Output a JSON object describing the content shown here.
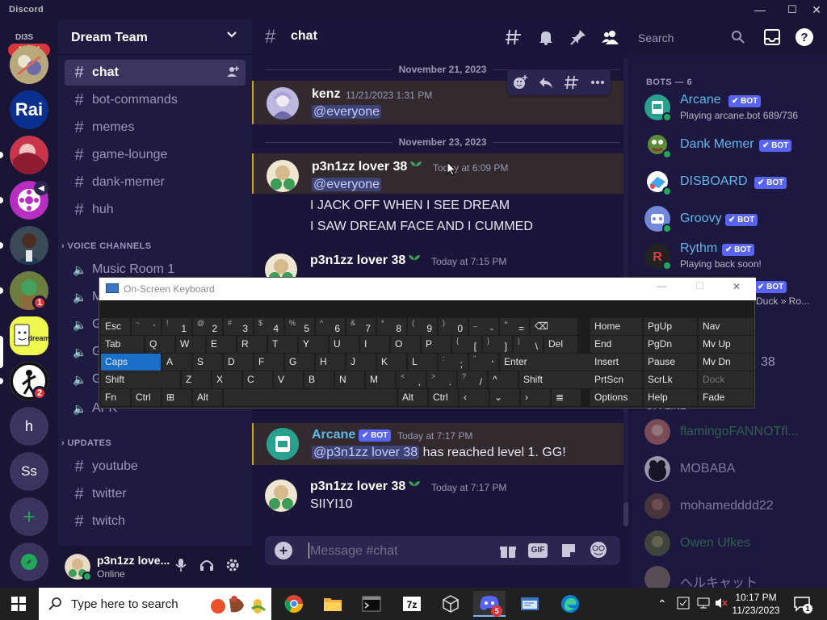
{
  "titlebar": {
    "app_name": "Discord",
    "minimize": "—",
    "maximize": "☐",
    "close": "✕"
  },
  "rail": {
    "unread_label": "DI3S",
    "new_label": "NEW",
    "servers": [
      {
        "name": "server-1"
      },
      {
        "name": "server-rai",
        "label": "Rai"
      },
      {
        "name": "server-3"
      },
      {
        "name": "server-4"
      },
      {
        "name": "server-5"
      },
      {
        "name": "server-6",
        "badge": "1"
      },
      {
        "name": "server-dream",
        "label": "dream"
      },
      {
        "name": "server-8",
        "badge": "2"
      },
      {
        "name": "server-h",
        "label": "h"
      },
      {
        "name": "server-ss",
        "label": "Ss"
      }
    ],
    "add_server": "+"
  },
  "sidebar": {
    "server_name": "Dream Team",
    "text_channels": [
      {
        "name": "chat",
        "active": true
      },
      {
        "name": "bot-commands"
      },
      {
        "name": "memes"
      },
      {
        "name": "game-lounge"
      },
      {
        "name": "dank-memer"
      },
      {
        "name": "huh"
      }
    ],
    "voice_category": "VOICE CHANNELS",
    "voice_channels": [
      "Music Room 1",
      "M",
      "G",
      "G",
      "G",
      "AFK"
    ],
    "updates_category": "UPDATES",
    "update_channels": [
      "youtube",
      "twitter",
      "twitch"
    ],
    "user": {
      "name": "p3n1zz love...",
      "status": "Online"
    }
  },
  "chat": {
    "channel_name": "chat",
    "search_placeholder": "Search",
    "dividers": [
      "November 21, 2023",
      "November 23, 2023"
    ],
    "messages": [
      {
        "author": "kenz",
        "timestamp": "11/21/2023 1:31 PM",
        "lines": [
          "@everyone"
        ]
      },
      {
        "author": "p3n1zz lover 38",
        "timestamp": "Today at 6:09 PM",
        "lines": [
          "@everyone",
          "I JACK OFF WHEN I SEE DREAM",
          "I SAW DREAM FACE AND I CUMMED"
        ]
      },
      {
        "author": "p3n1zz lover 38",
        "timestamp": "Today at 7:15 PM",
        "lines": [
          ""
        ]
      },
      {
        "author": "Arcane",
        "bot_tag": "BOT",
        "timestamp": "Today at 7:17 PM",
        "mention": "@p3n1zz lover 38",
        "text": " has reached level 1. GG!"
      },
      {
        "author": "p3n1zz lover 38",
        "timestamp": "Today at 7:17 PM",
        "lines": [
          "SIIYI10"
        ]
      }
    ],
    "composer_placeholder": "Message #chat",
    "gif_label": "GIF"
  },
  "members": {
    "bots_header": "BOTS — 6",
    "bots": [
      {
        "name": "Arcane",
        "status": "Playing arcane.bot 689/736",
        "color": "#5fb8e8"
      },
      {
        "name": "Dank Memer",
        "status": "",
        "color": "#5fb8e8"
      },
      {
        "name": "DISBOARD",
        "status": "",
        "color": "#5fb8e8"
      },
      {
        "name": "Groovy",
        "status": "",
        "color": "#5fb8e8"
      },
      {
        "name": "Rythm",
        "status": "Playing back soon!",
        "color": "#5fb8e8"
      },
      {
        "name": "",
        "status": "Duck » Ro...",
        "color": "#5fb8e8"
      }
    ],
    "bot_tag": "BOT",
    "partial_name": "38",
    "offline_header": "OFFLINE —",
    "offline": [
      "flamingoFANNOTfl...",
      "MOBABA",
      "mohamedddd22",
      "Owen Ufkes",
      "ヘルキャット"
    ]
  },
  "osk": {
    "title": "On-Screen Keyboard",
    "rows": [
      [
        {
          "m": "Esc"
        },
        {
          "s": "~",
          "b": "`"
        },
        {
          "s": "!",
          "b": "1"
        },
        {
          "s": "@",
          "b": "2"
        },
        {
          "s": "#",
          "b": "3"
        },
        {
          "s": "$",
          "b": "4"
        },
        {
          "s": "%",
          "b": "5"
        },
        {
          "s": "^",
          "b": "6"
        },
        {
          "s": "&",
          "b": "7"
        },
        {
          "s": "*",
          "b": "8"
        },
        {
          "s": "(",
          "b": "9"
        },
        {
          "s": ")",
          "b": "0"
        },
        {
          "s": "_",
          "b": "-"
        },
        {
          "s": "+",
          "b": "="
        },
        {
          "m": "⌫"
        }
      ],
      [
        {
          "m": "Tab"
        },
        {
          "m": "Q"
        },
        {
          "m": "W"
        },
        {
          "m": "E"
        },
        {
          "m": "R"
        },
        {
          "m": "T"
        },
        {
          "m": "Y"
        },
        {
          "m": "U"
        },
        {
          "m": "I"
        },
        {
          "m": "O"
        },
        {
          "m": "P"
        },
        {
          "s": "{",
          "b": "["
        },
        {
          "s": "}",
          "b": "]"
        },
        {
          "s": "|",
          "b": "\\"
        },
        {
          "m": "Del"
        }
      ],
      [
        {
          "m": "Caps",
          "hl": true
        },
        {
          "m": "A"
        },
        {
          "m": "S"
        },
        {
          "m": "D"
        },
        {
          "m": "F"
        },
        {
          "m": "G"
        },
        {
          "m": "H"
        },
        {
          "m": "J"
        },
        {
          "m": "K"
        },
        {
          "m": "L"
        },
        {
          "s": ":",
          "b": ";"
        },
        {
          "s": "\"",
          "b": "'"
        },
        {
          "m": "Enter"
        }
      ],
      [
        {
          "m": "Shift"
        },
        {
          "m": "Z"
        },
        {
          "m": "X"
        },
        {
          "m": "C"
        },
        {
          "m": "V"
        },
        {
          "m": "B"
        },
        {
          "m": "N"
        },
        {
          "m": "M"
        },
        {
          "s": "<",
          "b": ","
        },
        {
          "s": ">",
          "b": "."
        },
        {
          "s": "?",
          "b": "/"
        },
        {
          "m": "^"
        },
        {
          "m": "Shift"
        }
      ],
      [
        {
          "m": "Fn"
        },
        {
          "m": "Ctrl"
        },
        {
          "m": "⊞"
        },
        {
          "m": "Alt"
        },
        {
          "m": ""
        },
        {
          "m": "Alt"
        },
        {
          "m": "Ctrl"
        },
        {
          "m": "‹"
        },
        {
          "m": "⌄"
        },
        {
          "m": "›"
        },
        {
          "m": "≣"
        }
      ]
    ],
    "nav": [
      [
        "Home",
        "PgUp",
        "Nav"
      ],
      [
        "End",
        "PgDn",
        "Mv Up"
      ],
      [
        "Insert",
        "Pause",
        "Mv Dn"
      ],
      [
        "PrtScn",
        "ScrLk",
        "Dock"
      ],
      [
        "Options",
        "Help",
        "Fade"
      ]
    ]
  },
  "taskbar": {
    "search_placeholder": "Type here to search",
    "discord_badge": "5",
    "time": "10:17 PM",
    "date": "11/23/2023",
    "notif_count": "1"
  }
}
